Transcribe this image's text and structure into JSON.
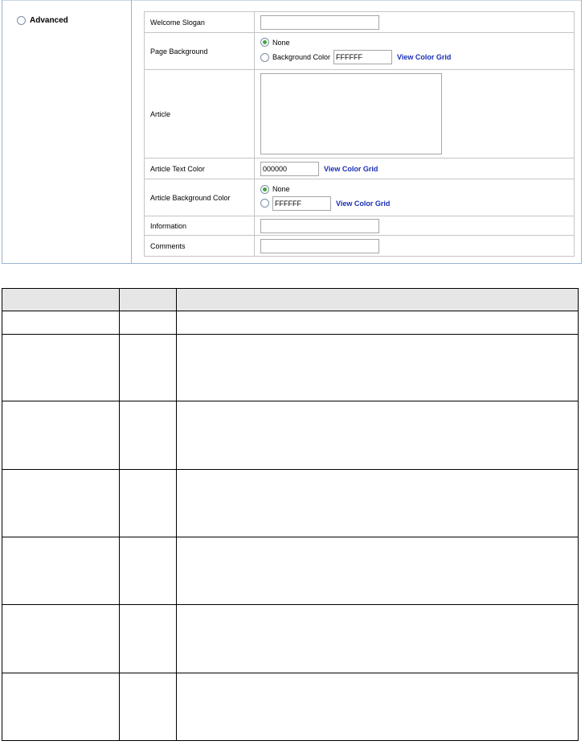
{
  "advanced": {
    "label": "Advanced"
  },
  "form": {
    "welcome_slogan": {
      "label": "Welcome Slogan",
      "value": ""
    },
    "page_background": {
      "label": "Page Background",
      "option_none": "None",
      "option_color": "Background Color",
      "color_value": "FFFFFF",
      "link": "View Color Grid"
    },
    "article": {
      "label": "Article",
      "value": ""
    },
    "article_text_color": {
      "label": "Article Text Color",
      "value": "000000",
      "link": "View Color Grid"
    },
    "article_background_color": {
      "label": "Article Background Color",
      "option_none": "None",
      "color_value": "FFFFFF",
      "link": "View Color Grid"
    },
    "information": {
      "label": "Information",
      "value": ""
    },
    "comments": {
      "label": "Comments",
      "value": ""
    }
  },
  "colors": {
    "panel_border": "#9cb3d0",
    "link": "#1a2fb5",
    "radio_selected": "#3fa53f",
    "table_header": "#e6e6e6"
  }
}
